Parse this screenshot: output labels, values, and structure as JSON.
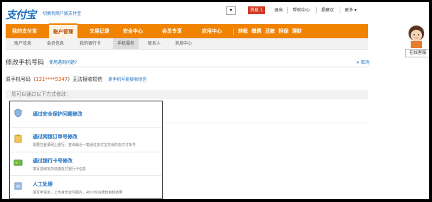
{
  "header": {
    "logo_text": "支付宝",
    "logo_sub": "切换到商户版支付宝",
    "dropdown": "▾",
    "message_badge": "消息 1",
    "links": [
      "退出",
      "帮助中心",
      "提建议",
      "更多 ▾"
    ]
  },
  "nav": {
    "items": [
      "我的支付宝",
      "账户管理",
      "交易记录",
      "安全中心",
      "会员专享",
      "应用中心",
      "转账",
      "缴费",
      "还款",
      "担保",
      "理财"
    ],
    "active_index": 1
  },
  "subnav": {
    "items": [
      "账户信息",
      "会员信息",
      "我的银行卡",
      "手机服务",
      "联系人",
      "消息中心"
    ],
    "active_index": 3
  },
  "page": {
    "title": "修改手机号码",
    "help_link": "使用遇到问题?",
    "cancel_link": "✕ 取消",
    "phone_prefix": "原手机号码（",
    "phone_number": "131****5347",
    "phone_suffix": "）无法接收短信",
    "phone_link": "原手机号能接收短信",
    "methods_header": "您可以通过以下方式修改："
  },
  "methods": [
    {
      "title": "通过安全保护问题修改",
      "desc": "",
      "icon": "shield-icon"
    },
    {
      "title": "通过网银订单号修改",
      "desc": "需要在登录网上银行，查询最近一笔通过支付宝交易的支付订单号",
      "icon": "clipboard-icon"
    },
    {
      "title": "通过银行卡号修改",
      "desc": "填写您绑定的快捷支付银行卡信息",
      "icon": "card-icon"
    },
    {
      "title": "人工处理",
      "desc": "填写申请单，上传身份证件图片，48小时内通知审核结果",
      "icon": "document-icon"
    }
  ],
  "customer_service": {
    "label": "在线客服",
    "icon": "avatar-icon"
  },
  "colors": {
    "orange": "#f08300",
    "link": "#1d6fbf",
    "accent_red": "#e04b00"
  }
}
